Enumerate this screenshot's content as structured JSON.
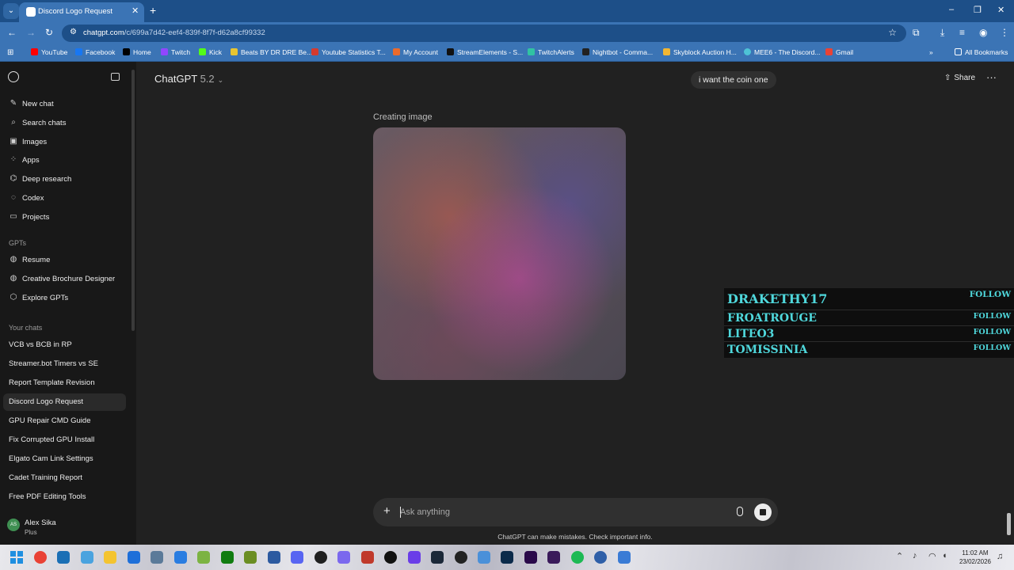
{
  "browser": {
    "tab_title": "Discord Logo Request",
    "new_tab": "+",
    "url_domain": "chatgpt.com",
    "url_path": "/c/699a7d42-eef4-839f-8f7f-d62a8cf99332",
    "bookmarks": [
      "YouTube",
      "Facebook",
      "Home",
      "Twitch",
      "Kick",
      "Beats BY DR DRE Be...",
      "Youtube Statistics T...",
      "My Account",
      "StreamElements - S...",
      "TwitchAlerts",
      "Nightbot - Comma...",
      "Skyblock Auction H...",
      "MEE6 - The Discord...",
      "Gmail"
    ],
    "all_bookmarks": "All Bookmarks",
    "overflow": "»"
  },
  "sidebar": {
    "nav": [
      {
        "icon": "new-chat-icon",
        "label": "New chat"
      },
      {
        "icon": "search-icon",
        "label": "Search chats"
      },
      {
        "icon": "images-icon",
        "label": "Images"
      },
      {
        "icon": "apps-icon",
        "label": "Apps"
      },
      {
        "icon": "deep-research-icon",
        "label": "Deep research"
      },
      {
        "icon": "codex-icon",
        "label": "Codex"
      },
      {
        "icon": "projects-icon",
        "label": "Projects"
      }
    ],
    "gpts_heading": "GPTs",
    "gpts": [
      {
        "icon": "resume-icon",
        "label": "Resume"
      },
      {
        "icon": "brochure-icon",
        "label": "Creative Brochure Designer"
      },
      {
        "icon": "explore-icon",
        "label": "Explore GPTs"
      }
    ],
    "chats_heading": "Your chats",
    "chats": [
      "VCB vs BCB in RP",
      "Streamer.bot Timers vs SE",
      "Report Template Revision",
      "Discord Logo Request",
      "GPU Repair CMD Guide",
      "Fix Corrupted GPU Install",
      "Elgato Cam Link Settings",
      "Cadet Training Report",
      "Free PDF Editing Tools"
    ],
    "active_chat": "Discord Logo Request",
    "user": {
      "initials": "AS",
      "name": "Alex Sika",
      "plan": "Plus"
    }
  },
  "main": {
    "model_name": "ChatGPT",
    "model_version": "5.2",
    "user_message": "i want the coin one",
    "share_label": "Share",
    "more_label": "···",
    "status": "Creating image",
    "composer_placeholder": "Ask anything",
    "disclaimer": "ChatGPT can make mistakes. Check important info."
  },
  "overlay": {
    "rows": [
      {
        "name": "DRAKETHY17",
        "action": "FOLLOW"
      },
      {
        "name": "FROATROUGE",
        "action": "FOLLOW"
      },
      {
        "name": "LITEO3",
        "action": "FOLLOW"
      },
      {
        "name": "TOMISSINIA",
        "action": "FOLLOW"
      }
    ]
  },
  "taskbar": {
    "time": "11:02 AM",
    "date": "23/02/2026"
  },
  "colors": {
    "browser_chrome": "#3b74b5",
    "sidebar_bg": "#181818",
    "main_bg": "#212121",
    "overlay_text": "#4fd8dc"
  }
}
